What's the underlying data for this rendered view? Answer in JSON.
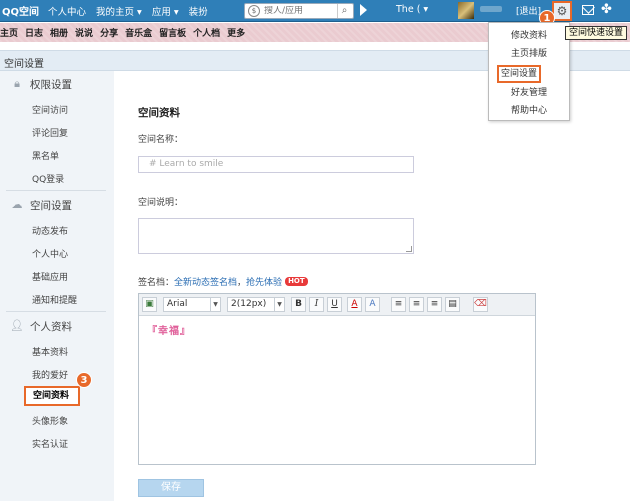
{
  "topbar": {
    "logo": "QQ空间",
    "nav": [
      "个人中心",
      "我的主页 ▾",
      "应用 ▾",
      "装扮"
    ],
    "search_placeholder": "搜人/应用",
    "friend_name": "The ( ▾",
    "exit_label": "[退出]"
  },
  "menu_row": [
    "主页",
    "日志",
    "相册",
    "说说",
    "分享",
    "音乐盒",
    "留言板",
    "个人档",
    "更多"
  ],
  "breadcrumb_title": "空间设置",
  "dropdown": {
    "items": [
      "修改资料",
      "主页排版",
      "空间设置",
      "好友管理",
      "帮助中心"
    ],
    "tooltip": "空间快速设置"
  },
  "badges": [
    "1",
    "2",
    "3"
  ],
  "sidebar": {
    "groups": [
      {
        "title": "权限设置",
        "icon": "lock-icon",
        "items": [
          "空间访问",
          "评论回复",
          "黑名单",
          "QQ登录"
        ]
      },
      {
        "title": "空间设置",
        "icon": "cloud-settings-icon",
        "items": [
          "动态发布",
          "个人中心",
          "基础应用",
          "通知和提醒"
        ]
      },
      {
        "title": "个人资料",
        "icon": "user-profile-icon",
        "items": [
          "基本资料",
          "我的爱好",
          "空间资料",
          "头像形象",
          "实名认证"
        ]
      }
    ]
  },
  "main": {
    "title": "空间资料",
    "name_label": "空间名称：",
    "name_value": "#  Learn  to  smile",
    "desc_label": "空间说明：",
    "sig_label": "签名档：",
    "sig_link1": "全新动态签名档",
    "sig_sep": "，",
    "sig_link2": "抢先体验",
    "hot": "HOT",
    "editor": {
      "font": "Arial",
      "size": "2(12px)",
      "content": "『幸福』"
    },
    "save_label": "保存"
  },
  "colors": {
    "topbar": "#2f7fb8",
    "accent_orange": "#e8692a",
    "pink_menu": "#eacbd0",
    "sidebar_bg": "#f0f4f8"
  }
}
